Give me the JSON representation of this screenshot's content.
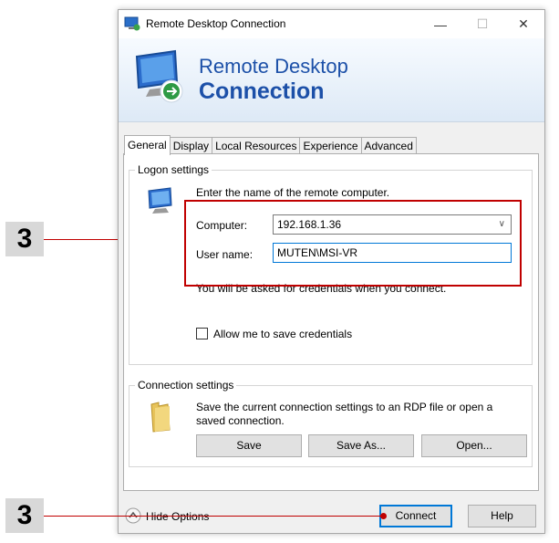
{
  "window": {
    "title": "Remote Desktop Connection"
  },
  "banner": {
    "line1": "Remote Desktop",
    "line2": "Connection"
  },
  "tabs": [
    {
      "label": "General",
      "active": true
    },
    {
      "label": "Display"
    },
    {
      "label": "Local Resources"
    },
    {
      "label": "Experience"
    },
    {
      "label": "Advanced"
    }
  ],
  "logon": {
    "title": "Logon settings",
    "instruction": "Enter the name of the remote computer.",
    "computer_label": "Computer:",
    "computer_value": "192.168.1.36",
    "username_label": "User name:",
    "username_value": "MUTEN\\MSI-VR",
    "note": "You will be asked for credentials when you connect.",
    "allow_save_label": "Allow me to save credentials",
    "allow_save_checked": false
  },
  "connection": {
    "title": "Connection settings",
    "description": "Save the current connection settings to an RDP file or open a saved connection.",
    "save_label": "Save",
    "save_as_label": "Save As...",
    "open_label": "Open..."
  },
  "footer": {
    "hide_options_label": "Hide Options",
    "connect_label": "Connect",
    "help_label": "Help"
  },
  "callouts": [
    {
      "label": "3"
    },
    {
      "label": "3"
    }
  ],
  "colors": {
    "accent": "#0078d7",
    "callout_red": "#c00000",
    "banner_text": "#1c50a8"
  }
}
